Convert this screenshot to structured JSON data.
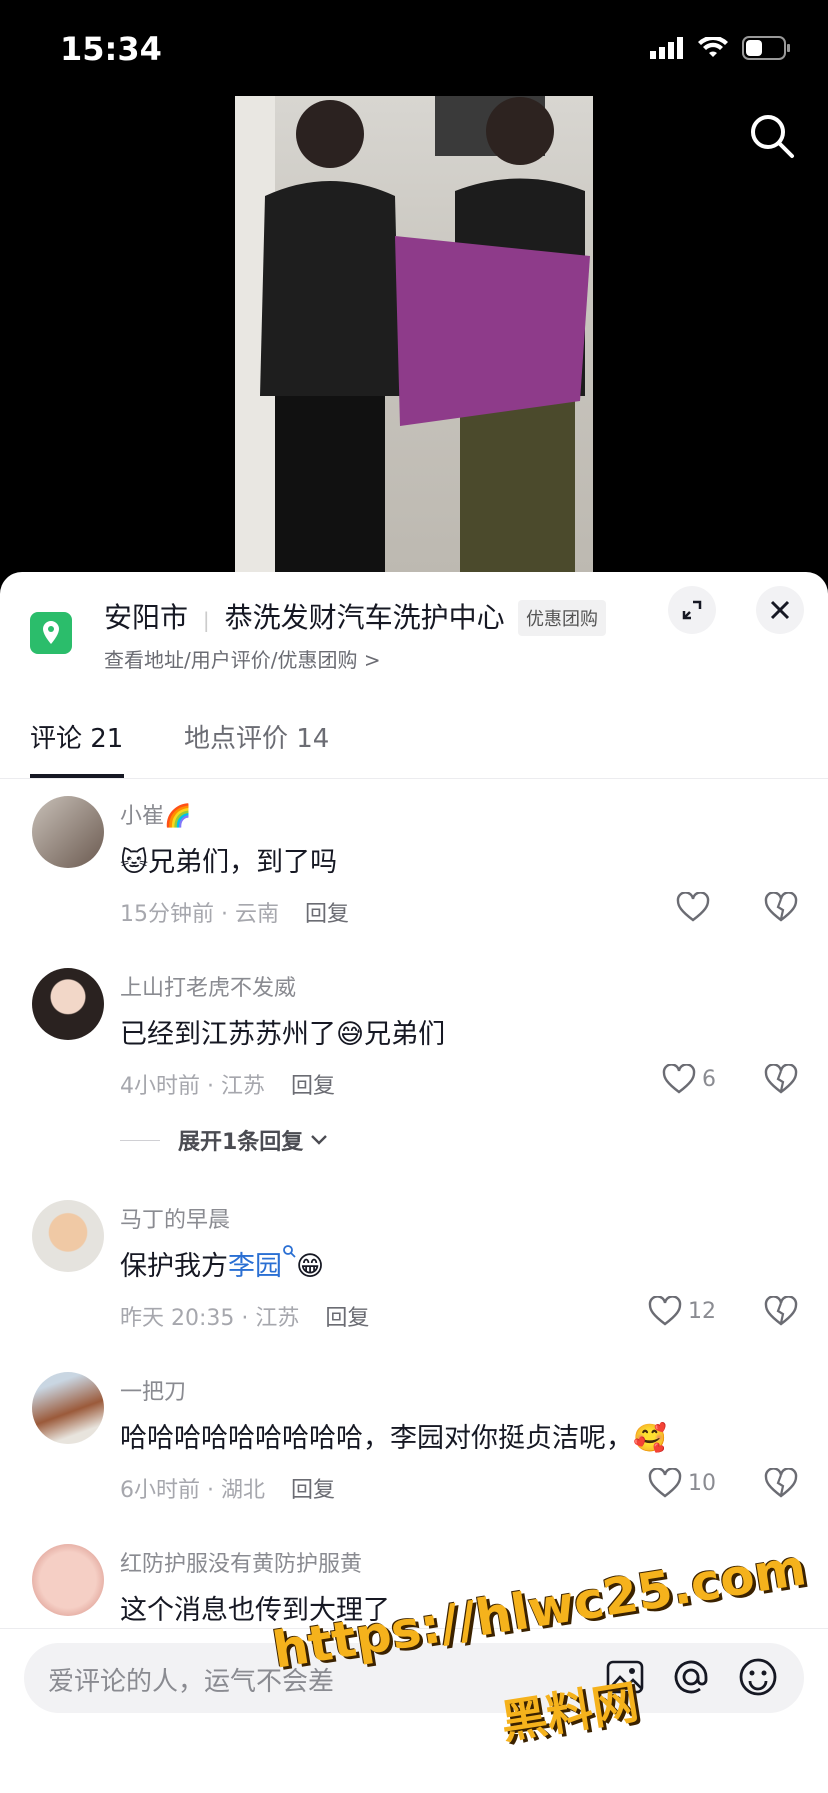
{
  "status_bar": {
    "time": "15:34"
  },
  "poi": {
    "city": "安阳市",
    "name": "恭洗发财汽车洗护中心",
    "tag": "优惠团购",
    "sub": "查看地址/用户评价/优惠团购 >"
  },
  "tabs": [
    {
      "label": "评论 21",
      "active": true
    },
    {
      "label": "地点评价 14",
      "active": false
    }
  ],
  "comments": [
    {
      "user": "小崔🌈",
      "text": "兄弟们，到了吗",
      "meta": "15分钟前 · 云南",
      "reply": "回复",
      "likes": ""
    },
    {
      "user": "上山打老虎不发威",
      "text": "已经到江苏苏州了😅兄弟们",
      "meta": "4小时前 · 江苏",
      "reply": "回复",
      "likes": "6",
      "expand": "展开1条回复"
    },
    {
      "user": "马丁的早晨",
      "text_pre": "保护我方",
      "mention": "李园",
      "text_post": "😁",
      "meta": "昨天 20:35 · 江苏",
      "reply": "回复",
      "likes": "12"
    },
    {
      "user": "一把刀",
      "text": "哈哈哈哈哈哈哈哈哈，李园对你挺贞洁呢，🥰",
      "meta": "6小时前 · 湖北",
      "reply": "回复",
      "likes": "10"
    },
    {
      "user": "红防护服没有黄防护服黄",
      "text": "这个消息也传到大理了"
    }
  ],
  "input": {
    "placeholder": "爱评论的人，运气不会差"
  },
  "watermark": {
    "line1": "https://hlwc25.com",
    "line2": "黑料网"
  },
  "colors": {
    "accent_green": "#2bbd6b",
    "mention_blue": "#2a6fd3"
  }
}
